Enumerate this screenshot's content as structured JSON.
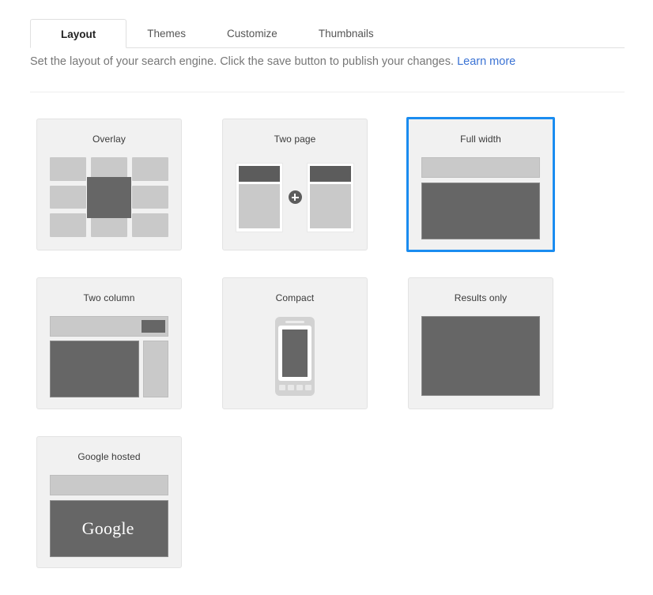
{
  "tabs": [
    {
      "label": "Layout",
      "active": true
    },
    {
      "label": "Themes",
      "active": false
    },
    {
      "label": "Customize",
      "active": false
    },
    {
      "label": "Thumbnails",
      "active": false
    }
  ],
  "description": {
    "text": "Set the layout of your search engine. Click the save button to publish your changes.",
    "link_label": "Learn more"
  },
  "colors": {
    "selected_border": "#1a8cf0",
    "link": "#3b73d4",
    "card_bg": "#f1f1f1",
    "dark_block": "#666666",
    "light_block": "#c9c9c9"
  },
  "layouts": [
    {
      "name": "Overlay",
      "selected": false
    },
    {
      "name": "Two page",
      "selected": false
    },
    {
      "name": "Full width",
      "selected": true
    },
    {
      "name": "Two column",
      "selected": false
    },
    {
      "name": "Compact",
      "selected": false
    },
    {
      "name": "Results only",
      "selected": false
    },
    {
      "name": "Google hosted",
      "selected": false,
      "logo_text": "Google",
      "logo_mark": "­"
    }
  ]
}
